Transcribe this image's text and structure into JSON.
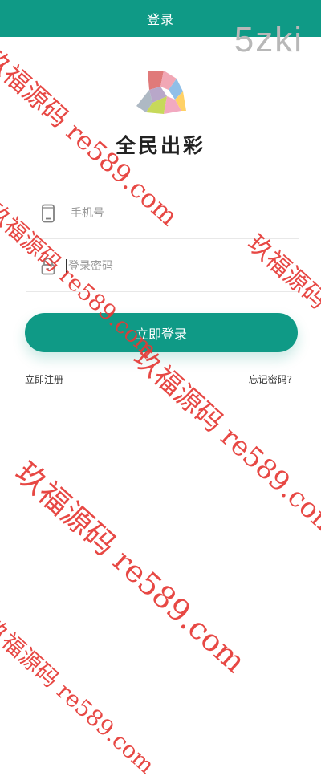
{
  "header": {
    "title": "登录"
  },
  "logo": {
    "text": "全民出彩"
  },
  "form": {
    "phone": {
      "placeholder": "手机号",
      "icon": "phone-icon"
    },
    "password": {
      "placeholder": "登录密码",
      "icon": "lock-icon"
    },
    "submit_label": "立即登录",
    "register_label": "立即注册",
    "forgot_label": "忘记密码?"
  },
  "watermark": {
    "text": "玖福源码 re589.com",
    "corner": "5zki"
  },
  "colors": {
    "primary": "#0f9a86",
    "watermark": "#e53935"
  }
}
